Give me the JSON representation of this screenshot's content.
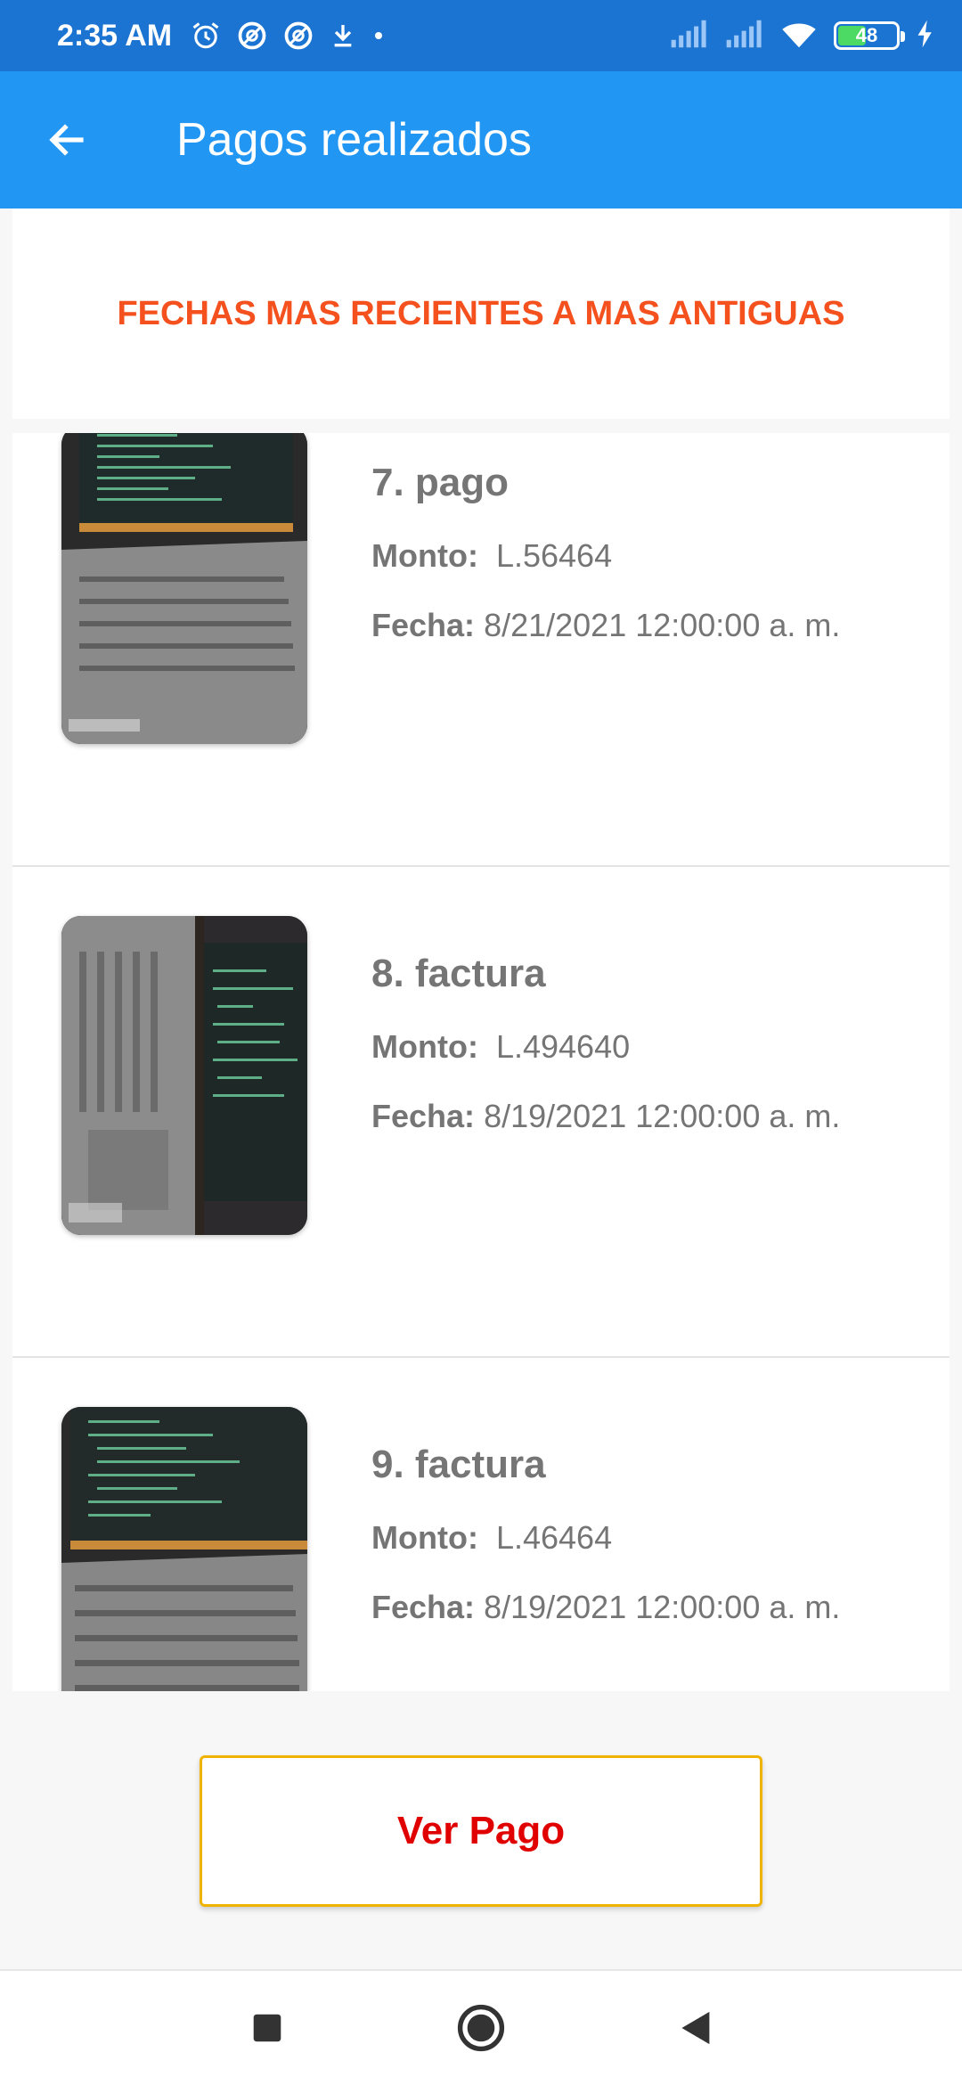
{
  "status_bar": {
    "time": "2:35 AM",
    "battery": "48",
    "icons": [
      "alarm-icon",
      "data-saver-icon",
      "data-saver-icon",
      "download-icon",
      "dot-icon",
      "signal-icon",
      "signal-icon",
      "wifi-icon",
      "battery-icon",
      "charging-icon"
    ]
  },
  "app_bar": {
    "title": "Pagos realizados"
  },
  "banner": {
    "text": "FECHAS MAS RECIENTES A MAS ANTIGUAS"
  },
  "payments": [
    {
      "title": "7. pago",
      "monto_label": "Monto:",
      "monto": "L.56464",
      "fecha_label": "Fecha:",
      "fecha": "8/21/2021 12:00:00 a. m."
    },
    {
      "title": "8. factura",
      "monto_label": "Monto:",
      "monto": "L.494640",
      "fecha_label": "Fecha:",
      "fecha": "8/19/2021 12:00:00 a. m."
    },
    {
      "title": "9. factura",
      "monto_label": "Monto:",
      "monto": "L.46464",
      "fecha_label": "Fecha:",
      "fecha": "8/19/2021 12:00:00 a. m."
    }
  ],
  "actions": {
    "ver_pago": "Ver Pago"
  },
  "colors": {
    "status_bar": "#1c74d2",
    "app_bar": "#2196f3",
    "banner_text": "#f4511e",
    "button_border": "#f0b400",
    "button_text": "#e00000"
  }
}
